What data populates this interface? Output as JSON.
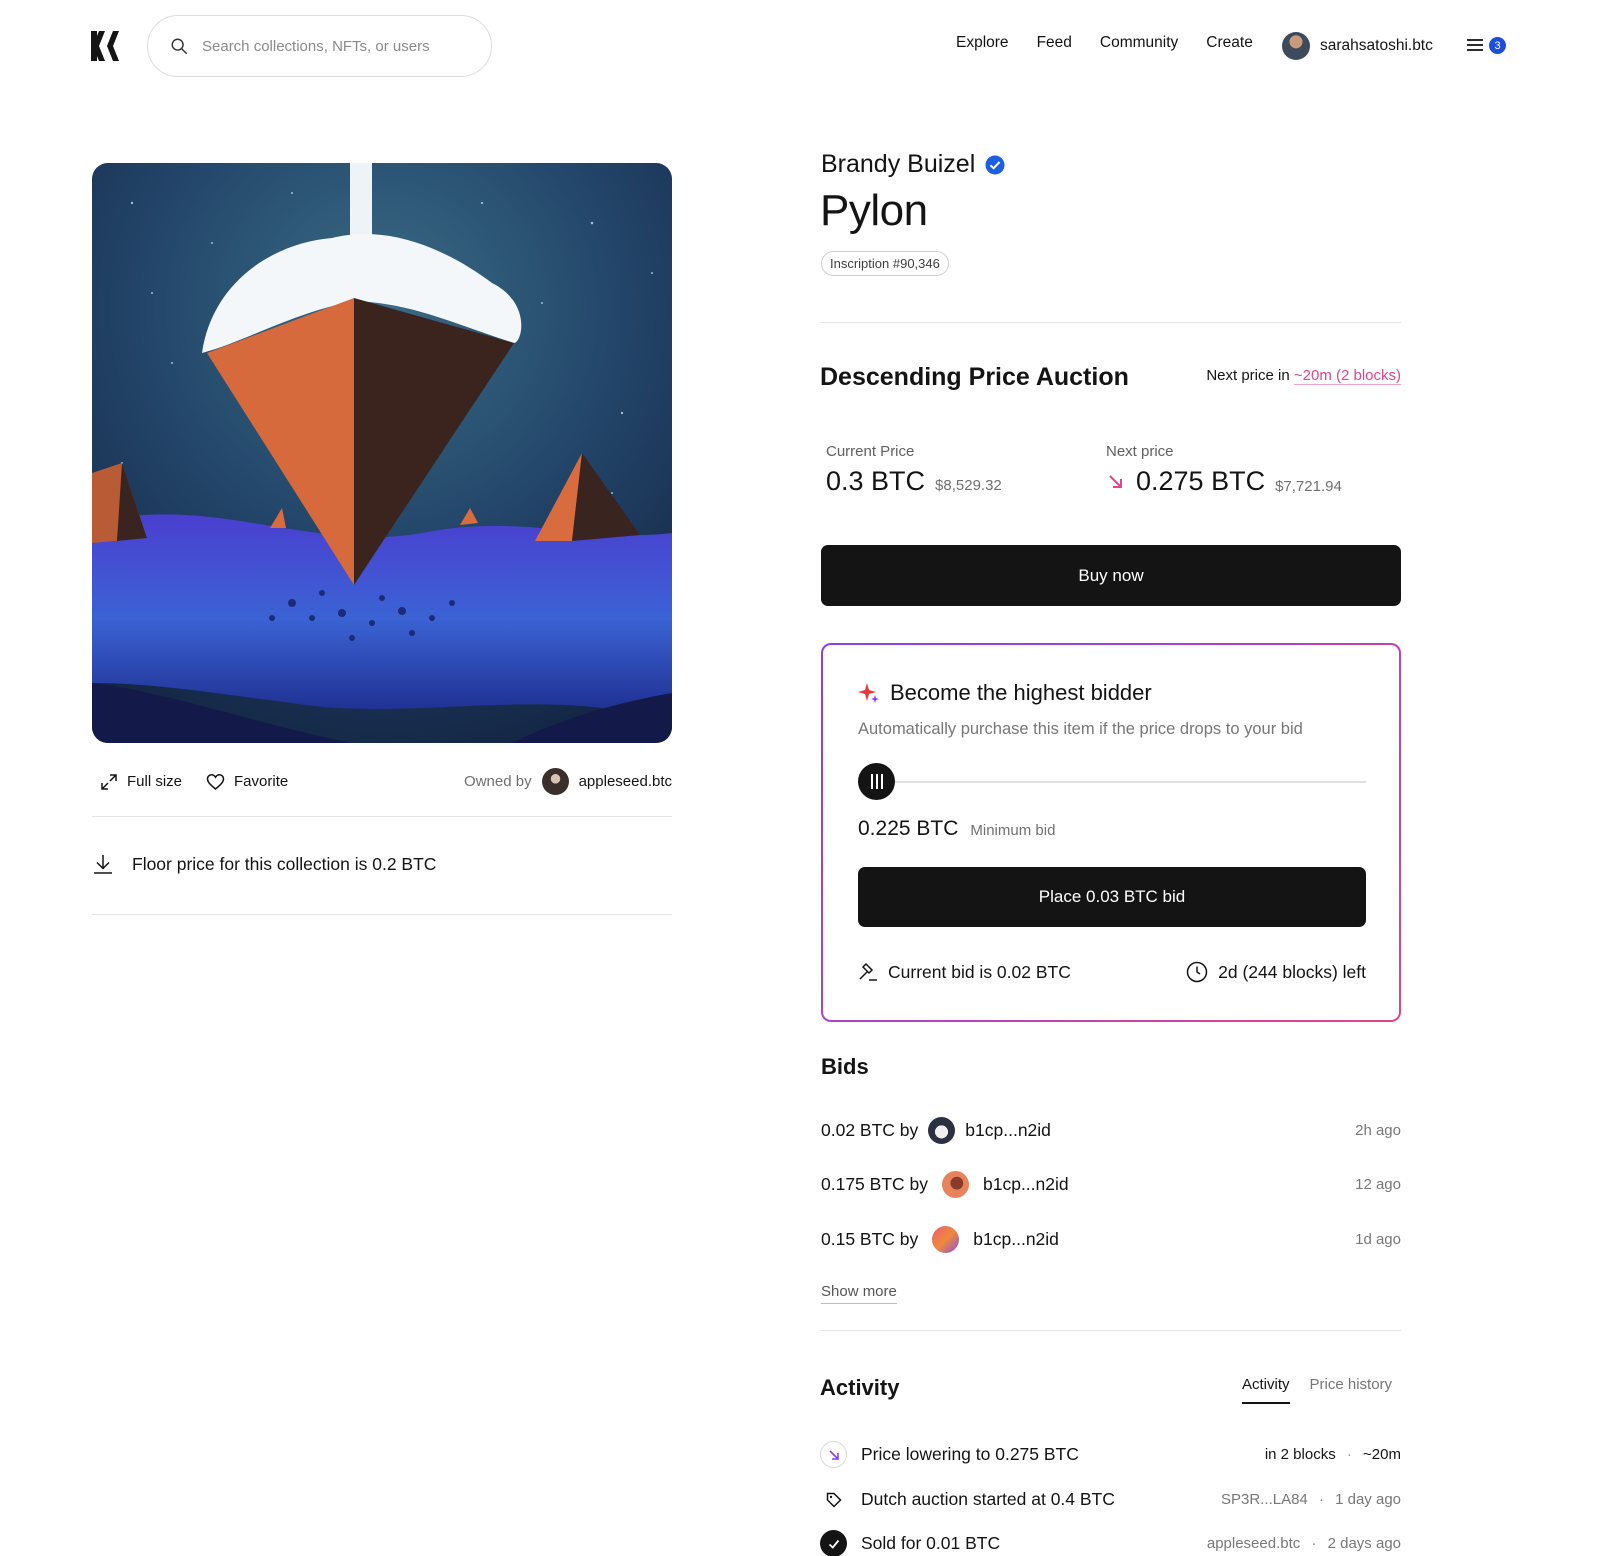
{
  "header": {
    "search_placeholder": "Search collections, NFTs, or users",
    "nav": [
      "Explore",
      "Feed",
      "Community",
      "Create"
    ],
    "username": "sarahsatoshi.btc",
    "notification_count": "3"
  },
  "artwork": {
    "full_size_label": "Full size",
    "favorite_label": "Favorite",
    "owned_by_label": "Owned by",
    "owner": "appleseed.btc",
    "floor_text": "Floor price for this collection is 0.2 BTC"
  },
  "item": {
    "creator": "Brandy Buizel",
    "title": "Pylon",
    "inscription": "Inscription #90,346"
  },
  "auction": {
    "title": "Descending Price Auction",
    "next_price_prefix": "Next price in",
    "next_price_time": "~20m (2 blocks)",
    "current_label": "Current Price",
    "current_price": "0.3 BTC",
    "current_usd": "$8,529.32",
    "next_label": "Next price",
    "next_price": "0.275 BTC",
    "next_usd": "$7,721.94",
    "buy_label": "Buy now"
  },
  "bid_box": {
    "heading": "Become the highest bidder",
    "subtitle": "Automatically purchase this item if the price drops to your bid",
    "min_bid_value": "0.225 BTC",
    "min_bid_label": "Minimum bid",
    "place_bid_label": "Place 0.03 BTC bid",
    "current_bid": "Current bid is 0.02 BTC",
    "time_left": "2d (244 blocks) left"
  },
  "bids": {
    "title": "Bids",
    "rows": [
      {
        "amount": "0.02 BTC by",
        "user": "b1cp...n2id",
        "time": "2h ago"
      },
      {
        "amount": "0.175 BTC by",
        "user": "b1cp...n2id",
        "time": "12 ago"
      },
      {
        "amount": "0.15 BTC by",
        "user": "b1cp...n2id",
        "time": "1d ago"
      }
    ],
    "show_more": "Show more"
  },
  "activity": {
    "title": "Activity",
    "tabs": [
      "Activity",
      "Price history"
    ],
    "rows": [
      {
        "text": "Price lowering to 0.275 BTC",
        "meta1": "in 2 blocks",
        "meta2": "~20m"
      },
      {
        "text": "Dutch auction started at 0.4 BTC",
        "meta1": "SP3R...LA84",
        "meta2": "1 day ago"
      },
      {
        "text": "Sold for 0.01 BTC",
        "meta1": "appleseed.btc",
        "meta2": "2 days ago"
      }
    ]
  },
  "colors": {
    "accent_pink": "#e2458a",
    "accent_purple": "#8a3ff0",
    "verified_blue": "#1d5fe0",
    "dark": "#141414"
  },
  "icons": [
    "logo-icon",
    "search-icon",
    "menu-icon",
    "expand-icon",
    "heart-icon",
    "download-icon",
    "verified-icon",
    "arrow-down-right-icon",
    "sparkle-icon",
    "gavel-icon",
    "clock-icon",
    "tag-icon",
    "check-icon"
  ]
}
